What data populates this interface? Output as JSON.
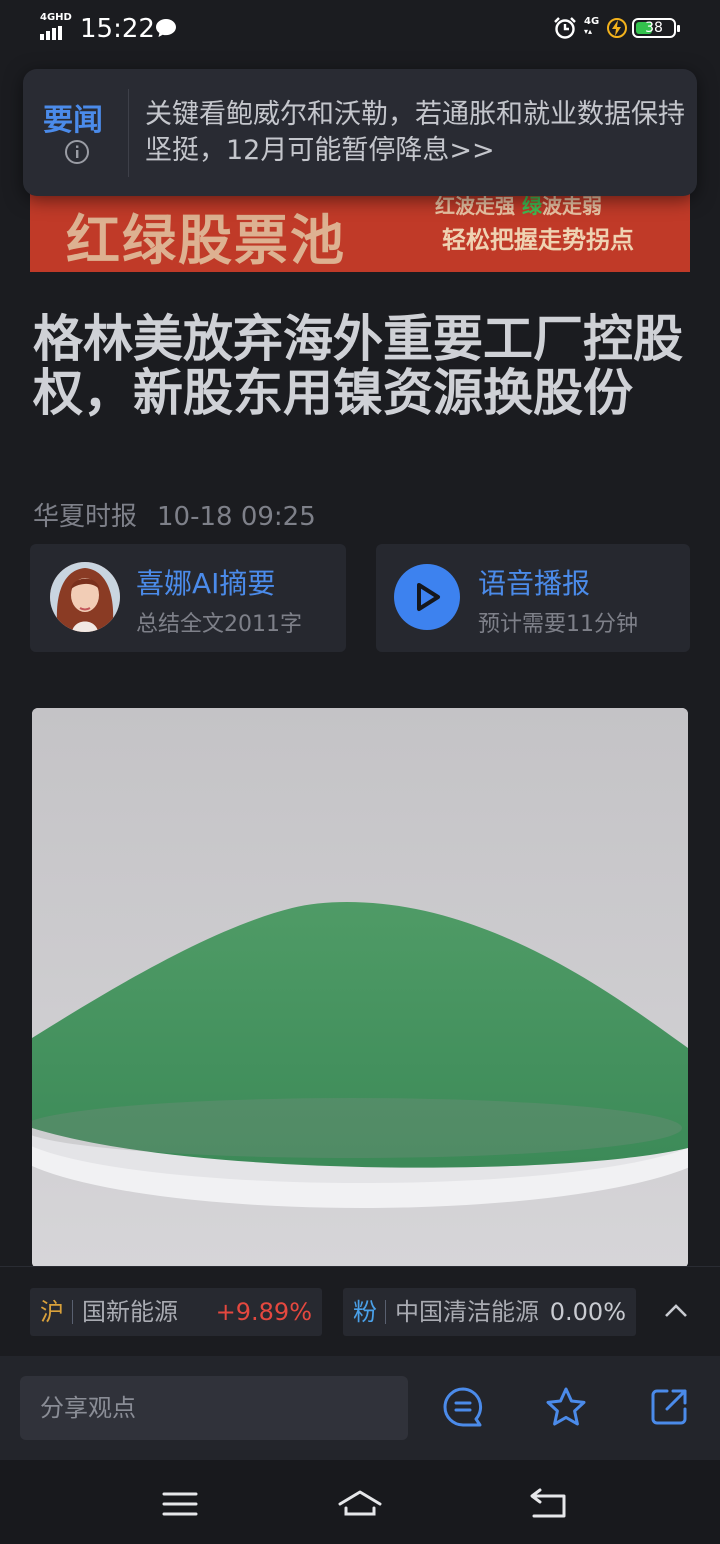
{
  "status_bar": {
    "network": "4GHD",
    "time": "15:22",
    "network_right": "4G",
    "battery": "38"
  },
  "news_popup": {
    "tag": "要闻",
    "text": "关键看鲍威尔和沃勒，若通胀和就业数据保持坚挺，12月可能暂停降息>>"
  },
  "banner": {
    "big_text": "红绿股票池",
    "line1_red": "红",
    "line1_a": "波走强",
    "line1_green": "绿",
    "line1_b": "波走弱",
    "line2": "轻松把握走势拐点"
  },
  "article": {
    "title": "格林美放弃海外重要工厂控股权，新股东用镍资源换股份",
    "source": "华夏时报",
    "datetime": "10-18 09:25"
  },
  "ai_summary": {
    "title": "喜娜AI摘要",
    "subtitle": "总结全文2011字"
  },
  "audio": {
    "title": "语音播报",
    "subtitle": "预计需要11分钟"
  },
  "stocks": [
    {
      "market": "沪",
      "name": "国新能源",
      "change": "+9.89%",
      "market_color": "#d9a13b",
      "change_color": "#e5483f"
    },
    {
      "market": "粉",
      "name": "中国清洁能源",
      "change": "0.00%",
      "market_color": "#4aa0e8",
      "change_color": "#c9cbd1"
    }
  ],
  "toolbar": {
    "share_placeholder": "分享观点"
  },
  "colors": {
    "accent": "#4b8bea",
    "background": "#1b1c20",
    "banner_red": "#c03a28"
  },
  "icons": [
    "message-icon",
    "alarm-icon",
    "charging-bolt-icon",
    "info-icon",
    "play-icon",
    "chevron-up-icon",
    "comment-icon",
    "star-icon",
    "share-icon",
    "menu-icon",
    "home-icon",
    "back-icon"
  ]
}
